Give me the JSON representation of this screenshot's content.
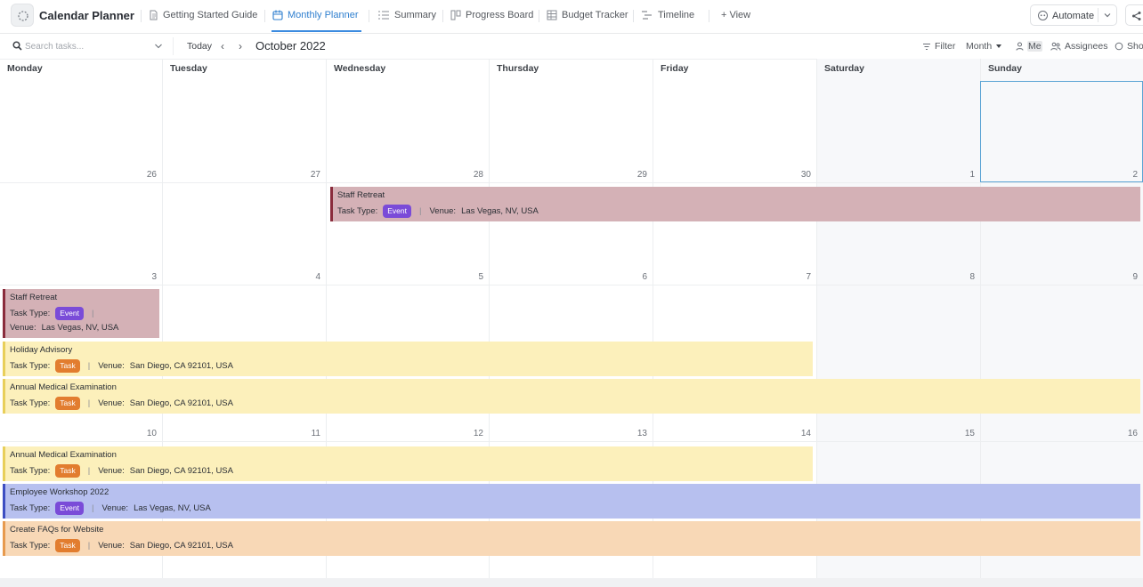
{
  "app": {
    "title": "Calendar Planner"
  },
  "tabs": [
    {
      "label": "Getting Started Guide",
      "icon": "doc-icon"
    },
    {
      "label": "Monthly Planner",
      "icon": "calendar-icon",
      "active": true
    },
    {
      "label": "Summary",
      "icon": "list-icon"
    },
    {
      "label": "Progress Board",
      "icon": "board-icon"
    },
    {
      "label": "Budget Tracker",
      "icon": "table-icon"
    },
    {
      "label": "Timeline",
      "icon": "timeline-icon"
    }
  ],
  "add_view_label": "+ View",
  "automate_label": "Automate",
  "toolbar": {
    "search_placeholder": "Search tasks...",
    "today_label": "Today",
    "prev_label": "‹",
    "next_label": "›",
    "month_title": "October 2022",
    "filter_label": "Filter",
    "month_label": "Month",
    "me_label": "Me",
    "assignees_label": "Assignees",
    "show_label": "Show"
  },
  "days": [
    "Monday",
    "Tuesday",
    "Wednesday",
    "Thursday",
    "Friday",
    "Saturday",
    "Sunday"
  ],
  "weeks": [
    [
      "26",
      "27",
      "28",
      "29",
      "30",
      "1",
      "2"
    ],
    [
      "3",
      "4",
      "5",
      "6",
      "7",
      "8",
      "9"
    ],
    [
      "10",
      "11",
      "12",
      "13",
      "14",
      "15",
      "16"
    ]
  ],
  "events": [
    {
      "title": "Staff Retreat",
      "type_label": "Task Type:",
      "type": "Event",
      "venue_label": "Venue:",
      "venue": "Las Vegas, NV, USA",
      "color": "#d4b1b6",
      "border": "#8a2c3c"
    },
    {
      "title": "Staff Retreat",
      "type_label": "Task Type:",
      "type": "Event",
      "venue_label": "Venue:",
      "venue": "Las Vegas, NV, USA",
      "color": "#d4b1b6",
      "border": "#8a2c3c"
    },
    {
      "title": "Holiday Advisory",
      "type_label": "Task Type:",
      "type": "Task",
      "venue_label": "Venue:",
      "venue": "San Diego, CA 92101, USA",
      "color": "#fcf0bb",
      "border": "#e8cf5a"
    },
    {
      "title": "Annual Medical Examination",
      "type_label": "Task Type:",
      "type": "Task",
      "venue_label": "Venue:",
      "venue": "San Diego, CA 92101, USA",
      "color": "#fcf0bb",
      "border": "#e8cf5a"
    },
    {
      "title": "Annual Medical Examination",
      "type_label": "Task Type:",
      "type": "Task",
      "venue_label": "Venue:",
      "venue": "San Diego, CA 92101, USA",
      "color": "#fcf0bb",
      "border": "#e8cf5a"
    },
    {
      "title": "Employee Workshop 2022",
      "type_label": "Task Type:",
      "type": "Event",
      "venue_label": "Venue:",
      "venue": "Las Vegas, NV, USA",
      "color": "#b7c0ef",
      "border": "#3d4ec2"
    },
    {
      "title": "Create FAQs for Website",
      "type_label": "Task Type:",
      "type": "Task",
      "venue_label": "Venue:",
      "venue": "San Diego, CA 92101, USA",
      "color": "#f8d8b6",
      "border": "#e79a4e"
    }
  ],
  "colors": {
    "accent": "#2f7fcf",
    "event_badge": "#7a4bd8",
    "task_badge": "#e27d2f",
    "weekend_bg": "#f7f8fa"
  }
}
